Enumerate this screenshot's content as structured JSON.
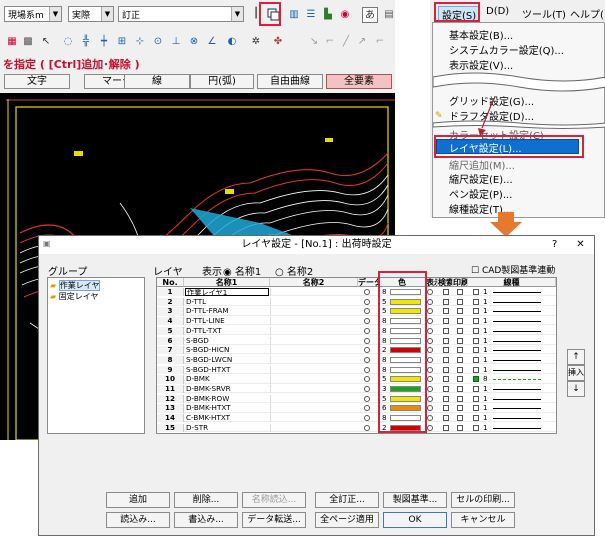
{
  "cad": {
    "combo_scale": "現場系m",
    "combo_mode": "実際",
    "combo_layer": "訂正",
    "prompt": "を指定 ( [Ctrl]追加･解除 )",
    "mode_buttons": [
      "文字",
      "マーク",
      "線",
      "円(弧)",
      "自由曲線",
      "全要素"
    ]
  },
  "menu": {
    "bar": [
      "設定(S)",
      "D(D)",
      "ツール(T)",
      "ヘルプ("
    ],
    "items": [
      "基本設定(B)...",
      "システムカラー設定(Q)...",
      "表示設定(V)...",
      "グリッド設定(G)...",
      "ドラフタ設定(D)...",
      "カラーセット設定(C)",
      "レイヤ設定(L)...",
      "縮尺設定(E)...",
      "ペン設定(P)...",
      "線種設定(T)..."
    ],
    "hidden_item": "縮尺追加(M)..."
  },
  "dialog": {
    "title": "レイヤ設定 - [No.1] : 出荷時設定",
    "help_glyph": "?",
    "close_glyph": "✕",
    "group_label": "グループ",
    "groups": [
      "作業レイヤ",
      "固定レイヤ"
    ],
    "layer_label": "レイヤ",
    "display_label": "表示",
    "radio1": "名称1",
    "radio2": "名称2",
    "cad_check": "CAD製図基準連動",
    "headers": [
      "No.",
      "名称1",
      "名称2",
      "データ",
      "色",
      "表示",
      "検索",
      "印刷",
      "線種"
    ],
    "rows": [
      {
        "no": "1",
        "name": "作業レイヤ1",
        "p": "8",
        "color": "#ffffff",
        "lt": "1"
      },
      {
        "no": "2",
        "name": "D-TTL",
        "p": "5",
        "color": "#f2e600",
        "lt": "1"
      },
      {
        "no": "3",
        "name": "D-TTL-FRAM",
        "p": "5",
        "color": "#f2e600",
        "lt": "1"
      },
      {
        "no": "4",
        "name": "D-TTL-LINE",
        "p": "8",
        "color": "#ffffff",
        "lt": "1"
      },
      {
        "no": "5",
        "name": "D-TTL-TXT",
        "p": "8",
        "color": "#ffffff",
        "lt": "1"
      },
      {
        "no": "6",
        "name": "S-BGD",
        "p": "8",
        "color": "#ffffff",
        "lt": "1"
      },
      {
        "no": "7",
        "name": "S-BGD-HICN",
        "p": "2",
        "color": "#d10000",
        "lt": "1"
      },
      {
        "no": "8",
        "name": "S-BGD-LWCN",
        "p": "8",
        "color": "#ffffff",
        "lt": "1"
      },
      {
        "no": "9",
        "name": "S-BGD-HTXT",
        "p": "8",
        "color": "#ffffff",
        "lt": "1"
      },
      {
        "no": "10",
        "name": "D-BMK",
        "p": "5",
        "color": "#f2e600",
        "lt": "8"
      },
      {
        "no": "11",
        "name": "D-BMK-SRVR",
        "p": "3",
        "color": "#1aa314",
        "lt": "1"
      },
      {
        "no": "12",
        "name": "D-BMK-ROW",
        "p": "5",
        "color": "#f2e600",
        "lt": "1"
      },
      {
        "no": "13",
        "name": "D-BMK-HTXT",
        "p": "6",
        "color": "#f08a00",
        "lt": "1"
      },
      {
        "no": "14",
        "name": "C-BMK-HTXT",
        "p": "8",
        "color": "#ffffff",
        "lt": "1"
      },
      {
        "no": "15",
        "name": "D-STR",
        "p": "2",
        "color": "#d10000",
        "lt": "1"
      }
    ],
    "side_buttons": [
      "↑",
      "挿入",
      "↓"
    ],
    "buttons_row1": [
      "追加",
      "削除...",
      "名称読込...",
      "全訂正...",
      "製図基準...",
      "セルの印刷..."
    ],
    "buttons_row2": [
      "読込み...",
      "書込み...",
      "データ転送...",
      "全ページ適用",
      "OK",
      "キャンセル"
    ]
  }
}
